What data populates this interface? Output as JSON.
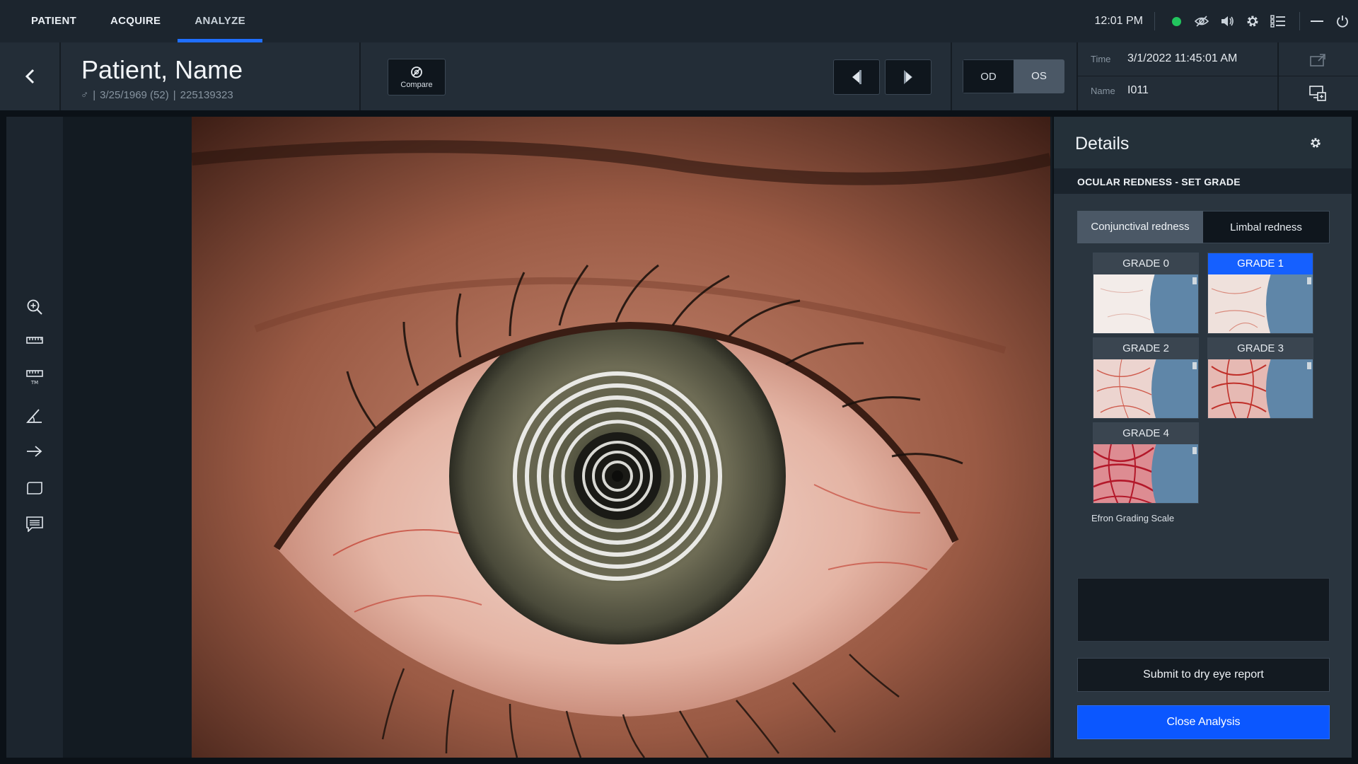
{
  "nav": {
    "tabs": [
      {
        "label": "PATIENT"
      },
      {
        "label": "ACQUIRE"
      },
      {
        "label": "ANALYZE"
      }
    ],
    "active_tab": "ANALYZE",
    "clock": "12:01 PM",
    "status_color": "#22c55e",
    "system_icons": [
      "status-dot",
      "eye-hidden-icon",
      "speaker-icon",
      "gear-icon",
      "list-icon",
      "minimize-icon",
      "power-icon"
    ]
  },
  "patient": {
    "name": "Patient, Name",
    "sex_symbol": "♂",
    "dob_age": "3/25/1969 (52)",
    "id": "225139323"
  },
  "header": {
    "compare_label": "Compare",
    "eye_options": [
      "OD",
      "OS"
    ],
    "selected_eye": "OS",
    "time_label": "Time",
    "time_value": "3/1/2022 11:45:01 AM",
    "name_label": "Name",
    "name_value": "I011"
  },
  "tools": [
    "zoom-in-icon",
    "ruler-icon",
    "ruler-tm-icon",
    "angle-icon",
    "arrow-icon",
    "shape-icon",
    "comment-icon"
  ],
  "details": {
    "title": "Details",
    "section_title": "OCULAR REDNESS - SET GRADE",
    "tabs": [
      "Conjunctival redness",
      "Limbal redness"
    ],
    "active_tab": "Conjunctival redness",
    "grades": [
      {
        "label": "GRADE 0"
      },
      {
        "label": "GRADE 1"
      },
      {
        "label": "GRADE 2"
      },
      {
        "label": "GRADE 3"
      },
      {
        "label": "GRADE 4"
      }
    ],
    "selected_grade": "GRADE 1",
    "scale_caption": "Efron Grading Scale",
    "notes_value": "",
    "submit_label": "Submit to dry eye report",
    "close_label": "Close Analysis"
  },
  "colors": {
    "accent": "#1560ff",
    "close_button": "#0b57ff",
    "toggle_selected": "#4b5866"
  }
}
